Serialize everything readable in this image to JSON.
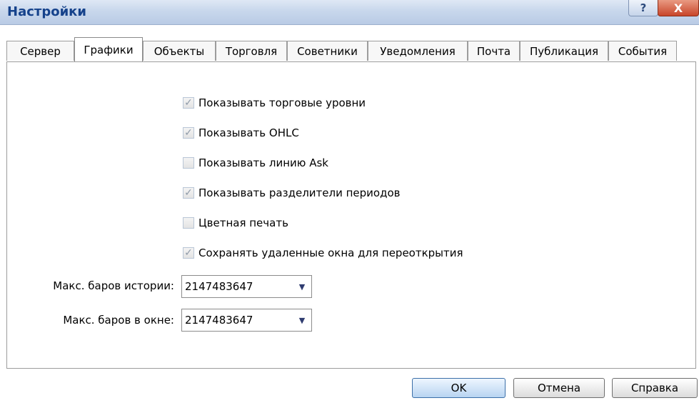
{
  "window": {
    "title": "Настройки",
    "help_glyph": "?",
    "close_glyph": "X"
  },
  "tabs": [
    {
      "label": "Сервер",
      "active": false
    },
    {
      "label": "Графики",
      "active": true
    },
    {
      "label": "Объекты",
      "active": false
    },
    {
      "label": "Торговля",
      "active": false
    },
    {
      "label": "Советники",
      "active": false
    },
    {
      "label": "Уведомления",
      "active": false
    },
    {
      "label": "Почта",
      "active": false
    },
    {
      "label": "Публикация",
      "active": false
    },
    {
      "label": "События",
      "active": false
    }
  ],
  "options": [
    {
      "label": "Показывать торговые уровни",
      "checked": true
    },
    {
      "label": "Показывать OHLC",
      "checked": true
    },
    {
      "label": "Показывать линию Ask",
      "checked": false
    },
    {
      "label": "Показывать разделители периодов",
      "checked": true
    },
    {
      "label": "Цветная печать",
      "checked": false
    },
    {
      "label": "Сохранять удаленные окна для переоткрытия",
      "checked": true
    }
  ],
  "fields": {
    "max_bars_history": {
      "label": "Макс. баров истории:",
      "value": "2147483647"
    },
    "max_bars_window": {
      "label": "Макс. баров в окне:",
      "value": "2147483647"
    }
  },
  "buttons": {
    "ok": "OK",
    "cancel": "Отмена",
    "help": "Справка"
  }
}
